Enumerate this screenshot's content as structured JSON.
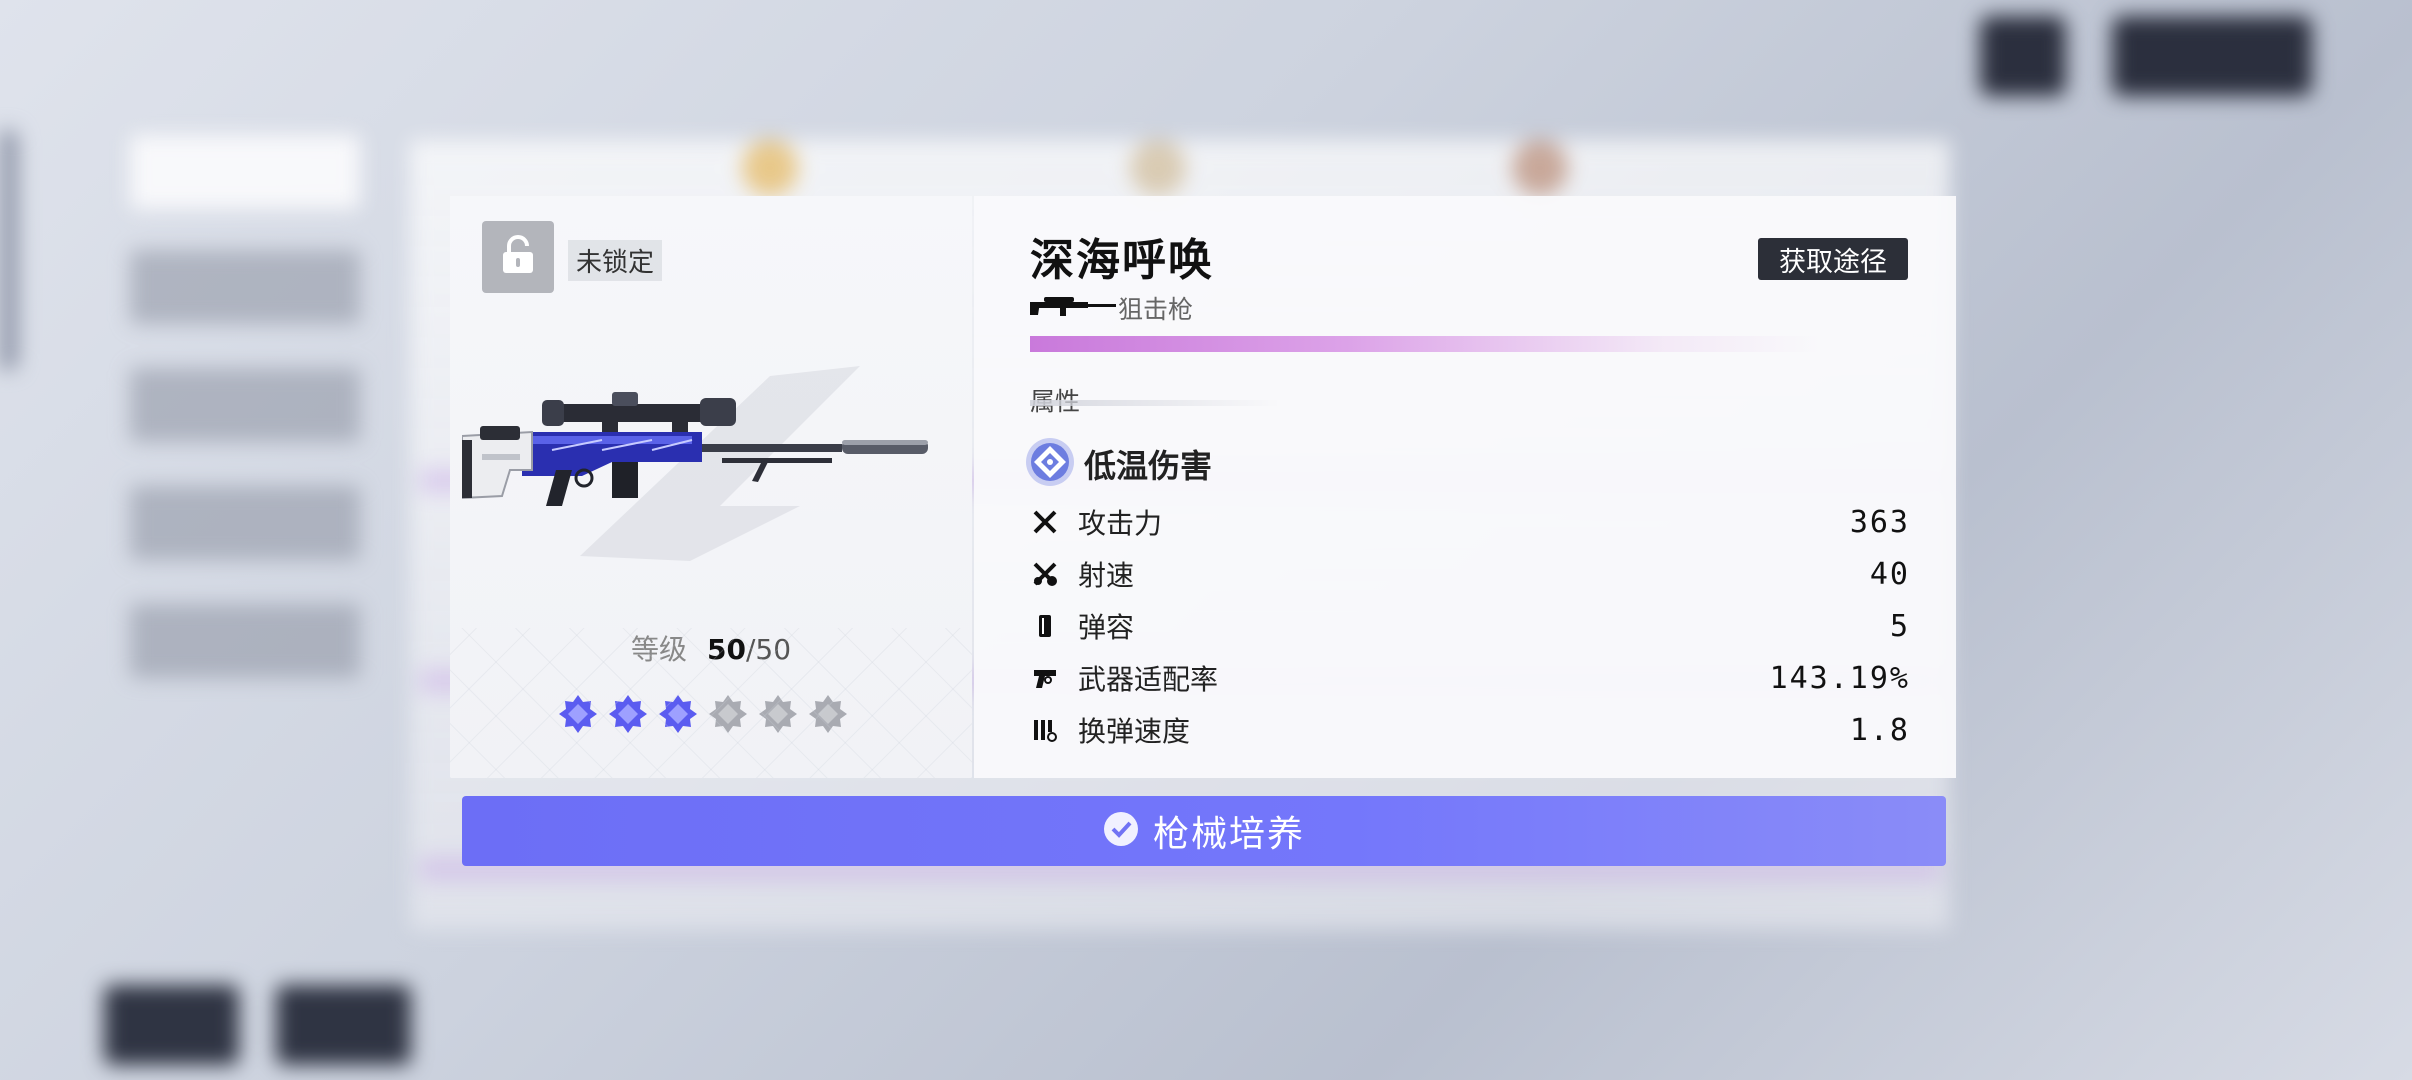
{
  "lock": {
    "label": "未锁定",
    "icon": "unlock-icon"
  },
  "weapon": {
    "name": "深海呼唤",
    "type_label": "狙击枪",
    "type_icon": "sniper-rifle-icon",
    "acquire_label": "获取途径",
    "level_label": "等级",
    "level_current": "50",
    "level_separator": "/",
    "level_max": "50",
    "stars_filled": 3,
    "stars_total": 6,
    "rarity_color": "#c979db"
  },
  "attributes": {
    "header": "属性",
    "element": {
      "label": "低温伤害",
      "icon": "cryo-element-icon",
      "color": "#6d7de0"
    },
    "stats": [
      {
        "label": "攻击力",
        "value": "363",
        "icon": "attack-icon"
      },
      {
        "label": "射速",
        "value": "40",
        "icon": "fire-rate-icon"
      },
      {
        "label": "弹容",
        "value": "5",
        "icon": "magazine-icon"
      },
      {
        "label": "武器适配率",
        "value": "143.19%",
        "icon": "adaptation-icon"
      },
      {
        "label": "换弹速度",
        "value": "1.8",
        "icon": "reload-icon"
      }
    ]
  },
  "train_button": {
    "label": "枪械培养",
    "icon": "check-circle-icon",
    "color": "#6c6ef6"
  }
}
